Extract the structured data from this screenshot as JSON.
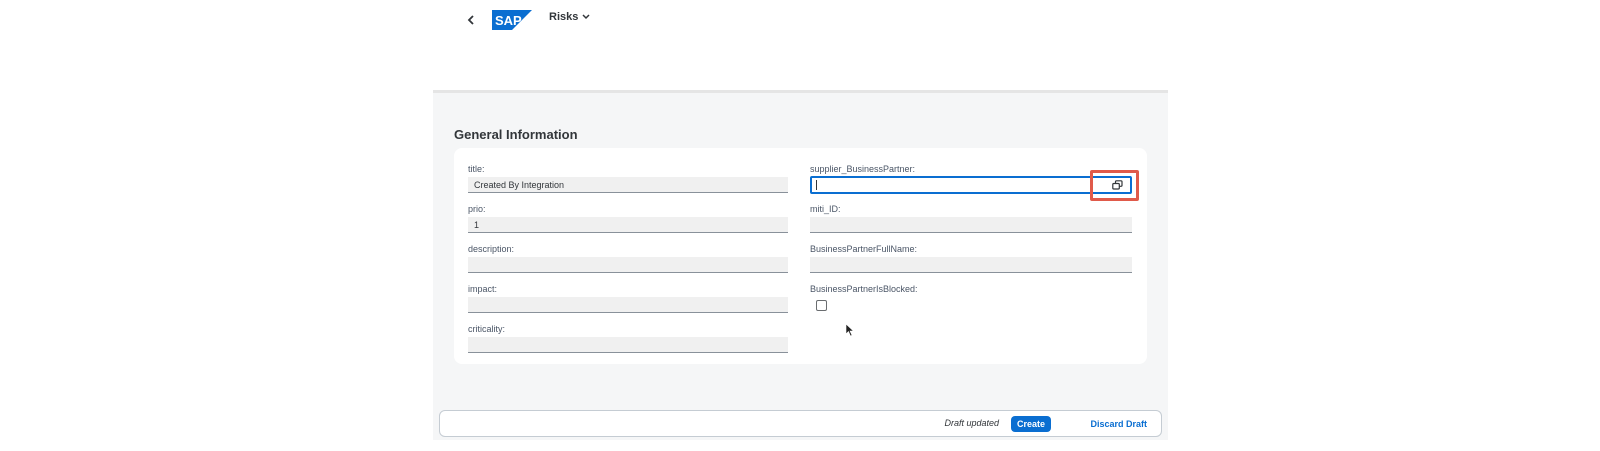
{
  "shell": {
    "back_icon": "chevron-left-icon",
    "logo_text": "SAP",
    "app_title": "Risks",
    "title_chevron": "chevron-down-icon",
    "brand_color": "#0a6ed1"
  },
  "section": {
    "title": "General Information"
  },
  "form": {
    "left": [
      {
        "label": "title:",
        "value": "Created By Integration"
      },
      {
        "label": "prio:",
        "value": "1"
      },
      {
        "label": "description:",
        "value": ""
      },
      {
        "label": "impact:",
        "value": ""
      },
      {
        "label": "criticality:",
        "value": ""
      }
    ],
    "right": [
      {
        "label": "supplier_BusinessPartner:",
        "value": "",
        "focused": true,
        "value_help_icon": "value-help-icon"
      },
      {
        "label": "miti_ID:",
        "value": ""
      },
      {
        "label": "BusinessPartnerFullName:",
        "value": ""
      },
      {
        "label": "BusinessPartnerIsBlocked:",
        "type": "checkbox",
        "checked": false
      }
    ]
  },
  "footer": {
    "status": "Draft updated",
    "create_label": "Create",
    "discard_label": "Discard Draft"
  },
  "annotation_color": "#e05a4a"
}
